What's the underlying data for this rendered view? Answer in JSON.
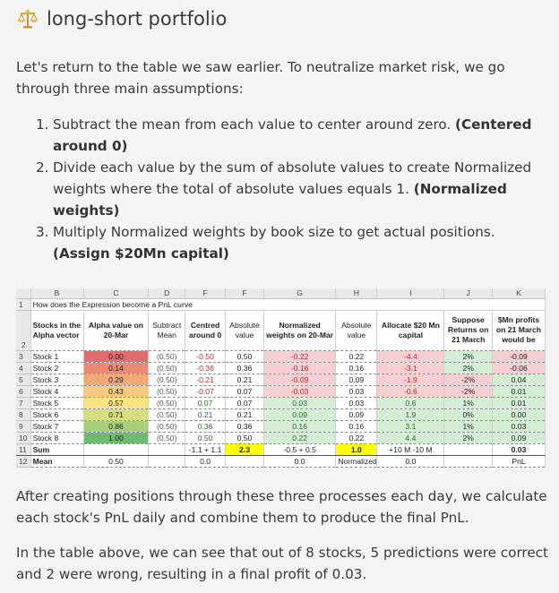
{
  "title": "long-short portfolio",
  "icon": "scales-icon",
  "intro": "Let's return to the table we saw earlier. To neutralize market risk, we go through three main assumptions:",
  "steps": [
    {
      "num": "1.",
      "text": "Subtract the mean from each value to center around zero.",
      "bold": "(Centered around 0)"
    },
    {
      "num": "2.",
      "text": "Divide each value by the sum of absolute values to create Normalized weights where the total of absolute values equals 1.",
      "bold": "(Normalized weights)"
    },
    {
      "num": "3.",
      "text": "Multiply Normalized weights by book size to get actual positions.",
      "bold": "(Assign $20Mn capital)"
    }
  ],
  "sheet": {
    "col_letters": [
      "",
      "B",
      "C",
      "D",
      "F",
      "F",
      "G",
      "H",
      "I",
      "J",
      "K"
    ],
    "row1_text": "How does the Expression become a PnL curve",
    "headers": [
      "Stocks in the Alpha vector",
      "Alpha value on 20-Mar",
      "Subtract Mean",
      "Centred around 0",
      "Absolute value",
      "Normalized weights on 20-Mar",
      "Absolute value",
      "Allocate $20 Mn capital",
      "Suppose Returns on 21 March",
      "$Mn profits on 21 March would be"
    ],
    "row_numbers": [
      "1",
      "2",
      "3",
      "4",
      "5",
      "6",
      "7",
      "8",
      "9",
      "10",
      "11",
      "12"
    ],
    "rows": [
      {
        "stock": "Stock 1",
        "alpha": "0.00",
        "sub": "(0.50)",
        "centred": "-0.50",
        "abs1": "0.50",
        "norm": "-0.22",
        "abs2": "0.22",
        "alloc": "-4.4",
        "ret": "2%",
        "profit": "-0.09",
        "alpha_color": "#e06c6e"
      },
      {
        "stock": "Stock 2",
        "alpha": "0.14",
        "sub": "(0.50)",
        "centred": "-0.36",
        "abs1": "0.36",
        "norm": "-0.16",
        "abs2": "0.16",
        "alloc": "-3.1",
        "ret": "2%",
        "profit": "-0.06",
        "alpha_color": "#ea8a75"
      },
      {
        "stock": "Stock 3",
        "alpha": "0.29",
        "sub": "(0.50)",
        "centred": "-0.21",
        "abs1": "0.21",
        "norm": "-0.09",
        "abs2": "0.09",
        "alloc": "-1.9",
        "ret": "-2%",
        "profit": "0.04",
        "alpha_color": "#f2a978"
      },
      {
        "stock": "Stock 4",
        "alpha": "0.43",
        "sub": "(0.50)",
        "centred": "-0.07",
        "abs1": "0.07",
        "norm": "-0.03",
        "abs2": "0.03",
        "alloc": "-0.6",
        "ret": "-2%",
        "profit": "0.01",
        "alpha_color": "#f7c97e"
      },
      {
        "stock": "Stock 5",
        "alpha": "0.57",
        "sub": "(0.50)",
        "centred": "0.07",
        "abs1": "0.07",
        "norm": "0.03",
        "abs2": "0.03",
        "alloc": "0.6",
        "ret": "1%",
        "profit": "0.01",
        "alpha_color": "#f9e484"
      },
      {
        "stock": "Stock 6",
        "alpha": "0.71",
        "sub": "(0.50)",
        "centred": "0.21",
        "abs1": "0.21",
        "norm": "0.09",
        "abs2": "0.09",
        "alloc": "1.9",
        "ret": "0%",
        "profit": "0.00",
        "alpha_color": "#d6de80"
      },
      {
        "stock": "Stock 7",
        "alpha": "0.86",
        "sub": "(0.50)",
        "centred": "0.36",
        "abs1": "0.36",
        "norm": "0.16",
        "abs2": "0.16",
        "alloc": "3.1",
        "ret": "1%",
        "profit": "0.03",
        "alpha_color": "#a8cf7e"
      },
      {
        "stock": "Stock 8",
        "alpha": "1.00",
        "sub": "(0.50)",
        "centred": "0.50",
        "abs1": "0.50",
        "norm": "0.22",
        "abs2": "0.22",
        "alloc": "4.4",
        "ret": "2%",
        "profit": "0.09",
        "alpha_color": "#6fbb72"
      }
    ],
    "sum_row": {
      "label": "Sum",
      "centred": "-1.1 + 1.1",
      "abs1": "2.3",
      "norm": "-0.5 + 0.5",
      "abs2": "1.0",
      "alloc": "+10 M -10 M",
      "profit": "0.03"
    },
    "mean_row": {
      "label": "Mean",
      "alpha": "0.50",
      "centred": "0.0",
      "norm": "0.0",
      "abs2": "Normalized",
      "alloc": "0.0",
      "profit": "PnL"
    }
  },
  "outro1": "After creating positions through these three processes each day, we calculate each stock's PnL daily and combine them to produce the final PnL.",
  "outro2": "In the table above, we can see that out of 8 stocks, 5 predictions were correct and 2 were wrong, resulting in a final profit of 0.03.",
  "colors": {
    "pink": "#f6cfd3",
    "green": "#d4edd5",
    "yellow": "#ffff00",
    "text": "#3a3a3a"
  }
}
